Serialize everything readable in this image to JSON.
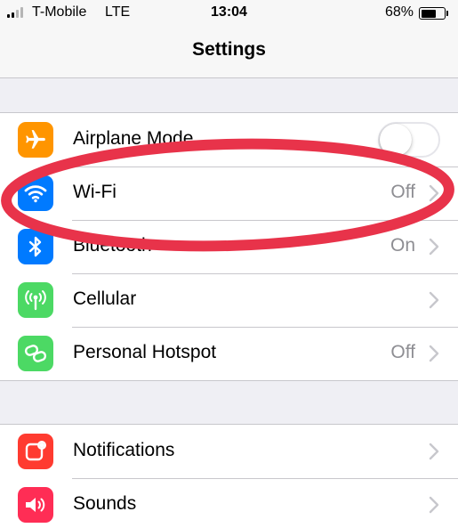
{
  "status_bar": {
    "carrier": "T-Mobile",
    "network": "LTE",
    "time": "13:04",
    "battery_percent": "68%",
    "battery_level": 0.68,
    "signal_bars_filled": 2,
    "signal_bars_total": 4
  },
  "nav": {
    "title": "Settings"
  },
  "group_1": {
    "airplane_mode": {
      "label": "Airplane Mode",
      "icon": "airplane-icon",
      "icon_color": "#ff9500",
      "toggle_on": false
    },
    "wifi": {
      "label": "Wi-Fi",
      "value": "Off",
      "icon": "wifi-icon",
      "icon_color": "#007aff"
    },
    "bluetooth": {
      "label": "Bluetooth",
      "value": "On",
      "icon": "bluetooth-icon",
      "icon_color": "#007aff"
    },
    "cellular": {
      "label": "Cellular",
      "icon": "cellular-antenna-icon",
      "icon_color": "#4cd964"
    },
    "hotspot": {
      "label": "Personal Hotspot",
      "value": "Off",
      "icon": "hotspot-link-icon",
      "icon_color": "#4cd964"
    }
  },
  "group_2": {
    "notifications": {
      "label": "Notifications",
      "icon": "notifications-icon",
      "icon_color": "#ff3b30"
    },
    "sounds": {
      "label": "Sounds",
      "icon": "speaker-icon",
      "icon_color": "#ff2d55"
    }
  },
  "annotation": {
    "shape": "red-ellipse",
    "color": "#e8334a",
    "highlights": "Wi-Fi row"
  }
}
